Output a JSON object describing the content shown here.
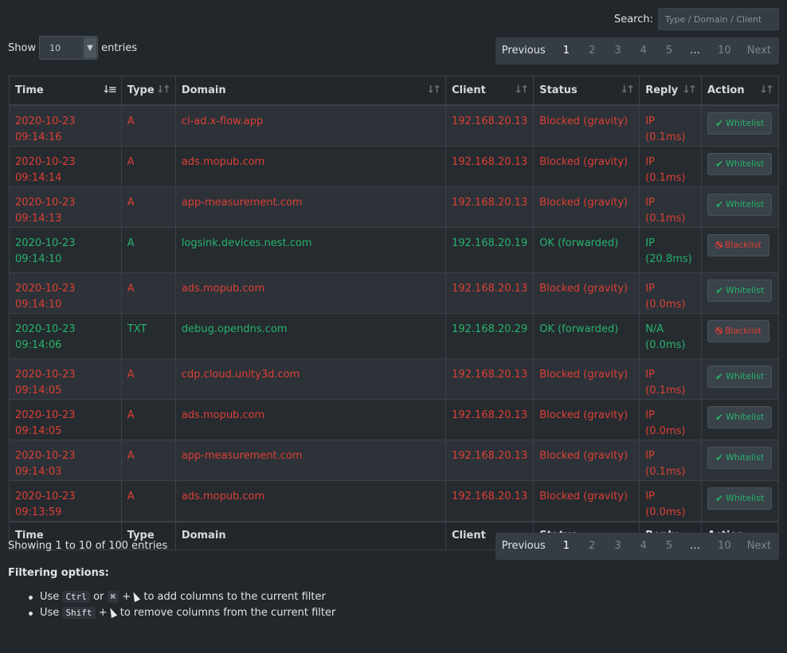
{
  "search": {
    "label": "Search:",
    "placeholder": "Type / Domain / Client"
  },
  "length": {
    "prefix": "Show",
    "value": "10",
    "suffix": "entries"
  },
  "pagination": {
    "previous": "Previous",
    "pages": [
      "1",
      "2",
      "3",
      "4",
      "5"
    ],
    "ellipsis": "…",
    "last": "10",
    "next": "Next",
    "active": "1"
  },
  "columns": [
    "Time",
    "Type",
    "Domain",
    "Client",
    "Status",
    "Reply",
    "Action"
  ],
  "rows": [
    {
      "time": "2020-10-23 09:14:16",
      "type": "A",
      "domain": "cl-ad.x-flow.app",
      "client": "192.168.20.13",
      "status": "Blocked (gravity)",
      "reply": "IP (0.1ms)",
      "action": "Whitelist",
      "state": "blocked"
    },
    {
      "time": "2020-10-23 09:14:14",
      "type": "A",
      "domain": "ads.mopub.com",
      "client": "192.168.20.13",
      "status": "Blocked (gravity)",
      "reply": "IP (0.1ms)",
      "action": "Whitelist",
      "state": "blocked"
    },
    {
      "time": "2020-10-23 09:14:13",
      "type": "A",
      "domain": "app-measurement.com",
      "client": "192.168.20.13",
      "status": "Blocked (gravity)",
      "reply": "IP (0.1ms)",
      "action": "Whitelist",
      "state": "blocked"
    },
    {
      "time": "2020-10-23 09:14:10",
      "type": "A",
      "domain": "logsink.devices.nest.com",
      "client": "192.168.20.19",
      "status": "OK (forwarded)",
      "reply": "IP (20.8ms)",
      "action": "Blacklist",
      "state": "ok"
    },
    {
      "time": "2020-10-23 09:14:10",
      "type": "A",
      "domain": "ads.mopub.com",
      "client": "192.168.20.13",
      "status": "Blocked (gravity)",
      "reply": "IP (0.0ms)",
      "action": "Whitelist",
      "state": "blocked"
    },
    {
      "time": "2020-10-23 09:14:06",
      "type": "TXT",
      "domain": "debug.opendns.com",
      "client": "192.168.20.29",
      "status": "OK (forwarded)",
      "reply": "N/A (0.0ms)",
      "action": "Blacklist",
      "state": "ok"
    },
    {
      "time": "2020-10-23 09:14:05",
      "type": "A",
      "domain": "cdp.cloud.unity3d.com",
      "client": "192.168.20.13",
      "status": "Blocked (gravity)",
      "reply": "IP (0.1ms)",
      "action": "Whitelist",
      "state": "blocked"
    },
    {
      "time": "2020-10-23 09:14:05",
      "type": "A",
      "domain": "ads.mopub.com",
      "client": "192.168.20.13",
      "status": "Blocked (gravity)",
      "reply": "IP (0.0ms)",
      "action": "Whitelist",
      "state": "blocked"
    },
    {
      "time": "2020-10-23 09:14:03",
      "type": "A",
      "domain": "app-measurement.com",
      "client": "192.168.20.13",
      "status": "Blocked (gravity)",
      "reply": "IP (0.1ms)",
      "action": "Whitelist",
      "state": "blocked"
    },
    {
      "time": "2020-10-23 09:13:59",
      "type": "A",
      "domain": "ads.mopub.com",
      "client": "192.168.20.13",
      "status": "Blocked (gravity)",
      "reply": "IP (0.0ms)",
      "action": "Whitelist",
      "state": "blocked"
    }
  ],
  "info": "Showing 1 to 10 of 100 entries",
  "filtering": {
    "title": "Filtering options:",
    "line1": {
      "use": "Use",
      "key1": "Ctrl",
      "or": "or",
      "key2": "⌘",
      "plus": "+",
      "text": "to add columns to the current filter"
    },
    "line2": {
      "use": "Use",
      "key1": "Shift",
      "plus": "+",
      "text": "to remove columns from the current filter"
    }
  },
  "colors": {
    "blocked": "#dd3f34",
    "ok": "#26b36b",
    "background": "#22272c"
  }
}
